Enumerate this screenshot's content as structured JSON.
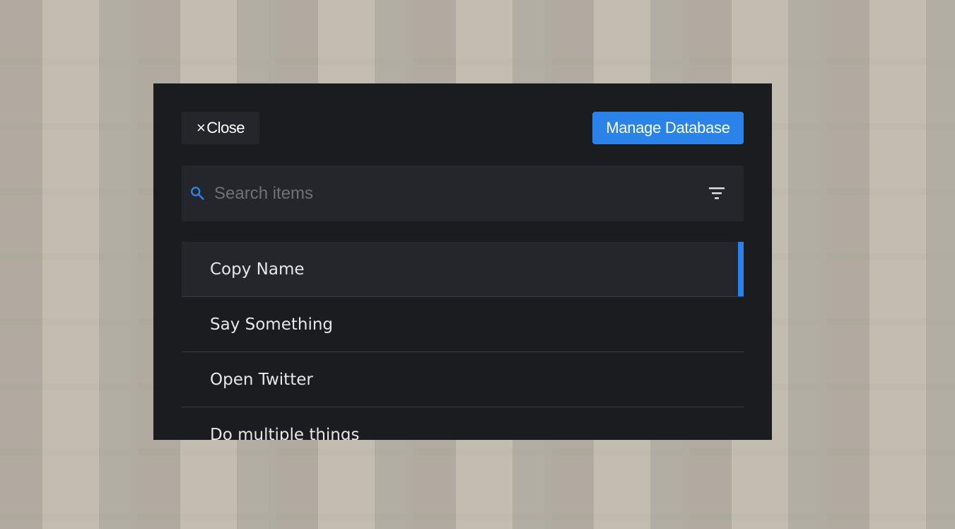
{
  "header": {
    "close_label": "Close",
    "close_icon": "×",
    "manage_label": "Manage Database"
  },
  "search": {
    "placeholder": "Search items",
    "value": ""
  },
  "items": [
    {
      "label": "Copy Name",
      "selected": true
    },
    {
      "label": "Say Something",
      "selected": false
    },
    {
      "label": "Open Twitter",
      "selected": false
    },
    {
      "label": "Do multiple things",
      "selected": false
    }
  ],
  "colors": {
    "accent": "#2b82e8",
    "dialog_bg": "#1b1c20",
    "panel_bg": "#25262b"
  }
}
